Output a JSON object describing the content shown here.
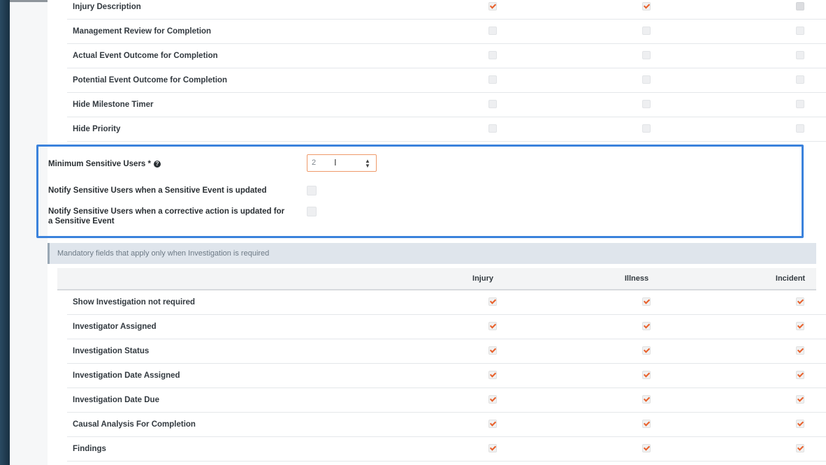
{
  "top_rows": [
    {
      "label": "Injury Description",
      "injury": true,
      "illness": true,
      "incident": "disabled"
    },
    {
      "label": "Management Review for Completion",
      "injury": false,
      "illness": false,
      "incident": false
    },
    {
      "label": "Actual Event Outcome for Completion",
      "injury": false,
      "illness": false,
      "incident": false
    },
    {
      "label": "Potential Event Outcome for Completion",
      "injury": false,
      "illness": false,
      "incident": false
    },
    {
      "label": "Hide Milestone Timer",
      "injury": false,
      "illness": false,
      "incident": false
    },
    {
      "label": "Hide Priority",
      "injury": false,
      "illness": false,
      "incident": false
    }
  ],
  "sensitive": {
    "min_label": "Minimum Sensitive Users *",
    "min_value": "2",
    "notify_event_label": "Notify Sensitive Users when a Sensitive Event is updated",
    "notify_action_label_line1": "Notify Sensitive Users when a corrective action is updated for",
    "notify_action_label_line2": "a Sensitive Event"
  },
  "info_text": "Mandatory fields that apply only when Investigation is required",
  "columns": [
    "Injury",
    "Illness",
    "Incident"
  ],
  "investigation_rows": [
    {
      "label": "Show Investigation not required"
    },
    {
      "label": "Investigator Assigned"
    },
    {
      "label": "Investigation Status"
    },
    {
      "label": "Investigation Date Assigned"
    },
    {
      "label": "Investigation Date Due"
    },
    {
      "label": "Causal Analysis For Completion"
    },
    {
      "label": "Findings"
    }
  ],
  "colors": {
    "accent": "#e8612c",
    "highlight_border": "#3b82dc"
  }
}
